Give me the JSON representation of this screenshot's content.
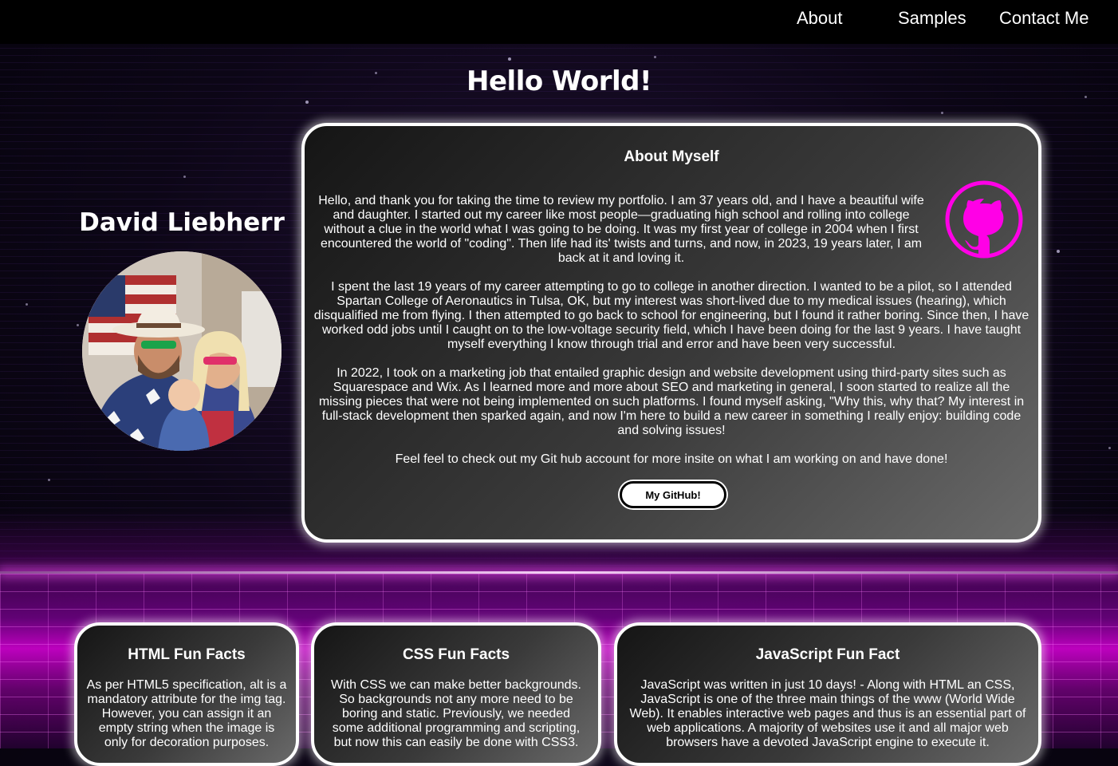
{
  "nav": {
    "items": [
      {
        "label": "About"
      },
      {
        "label": "Samples"
      },
      {
        "label": "Contact Me"
      }
    ]
  },
  "page": {
    "title": "Hello World!"
  },
  "profile": {
    "name": "David Liebherr"
  },
  "about": {
    "title": "About Myself",
    "paragraphs": [
      "Hello, and thank you for taking the time to review my portfolio. I am 37 years old, and I have a beautiful wife and daughter. I started out my career like most people—graduating high school and rolling into college without a clue in the world what I was going to be doing. It was my first year of college in 2004 when I first encountered the world of \"coding\". Then life had its' twists and turns, and now, in 2023, 19 years later, I am back at it and loving it.",
      "I spent the last 19 years of my career attempting to go to college in another direction. I wanted to be a pilot, so I attended Spartan College of Aeronautics in Tulsa, OK, but my interest was short-lived due to my medical issues (hearing), which disqualified me from flying. I then attempted to go back to school for engineering, but I found it rather boring. Since then, I have worked odd jobs until I caught on to the low-voltage security field, which I have been doing for the last 9 years. I have taught myself everything I know through trial and error and have been very successful.",
      "In 2022, I took on a marketing job that entailed graphic design and website development using third-party sites such as Squarespace and Wix. As I learned more and more about SEO and marketing in general, I soon started to realize all the missing pieces that were not being implemented on such platforms. I found myself asking, \"Why this, why that? My interest in full-stack development then sparked again, and now I'm here to build a new career in something I really enjoy: building code and solving issues!",
      "Feel feel to check out my Git hub account for more insite on what I am working on and have done!"
    ],
    "github_button": "My GitHub!",
    "github_icon": "github-octocat-icon",
    "accent_color": "#ff00e6"
  },
  "facts": [
    {
      "title": "HTML Fun Facts",
      "body": "As per HTML5 specification, alt is a mandatory attribute for the img tag. However, you can assign it an empty string when the image is only for decoration purposes."
    },
    {
      "title": "CSS Fun Facts",
      "body": "With CSS we can make better backgrounds. So backgrounds not any more need to be boring and static. Previously, we needed some additional programming and scripting, but now this can easily be done with CSS3."
    },
    {
      "title": "JavaScript Fun Fact",
      "body": "JavaScript was written in just 10 days! - Along with HTML an CSS, JavaScript is one of the three main things of the www (World Wide Web). It enables interactive web pages and thus is an essential part of web applications. A majority of websites use it and all major web browsers have a devoted JavaScript engine to execute it."
    }
  ]
}
